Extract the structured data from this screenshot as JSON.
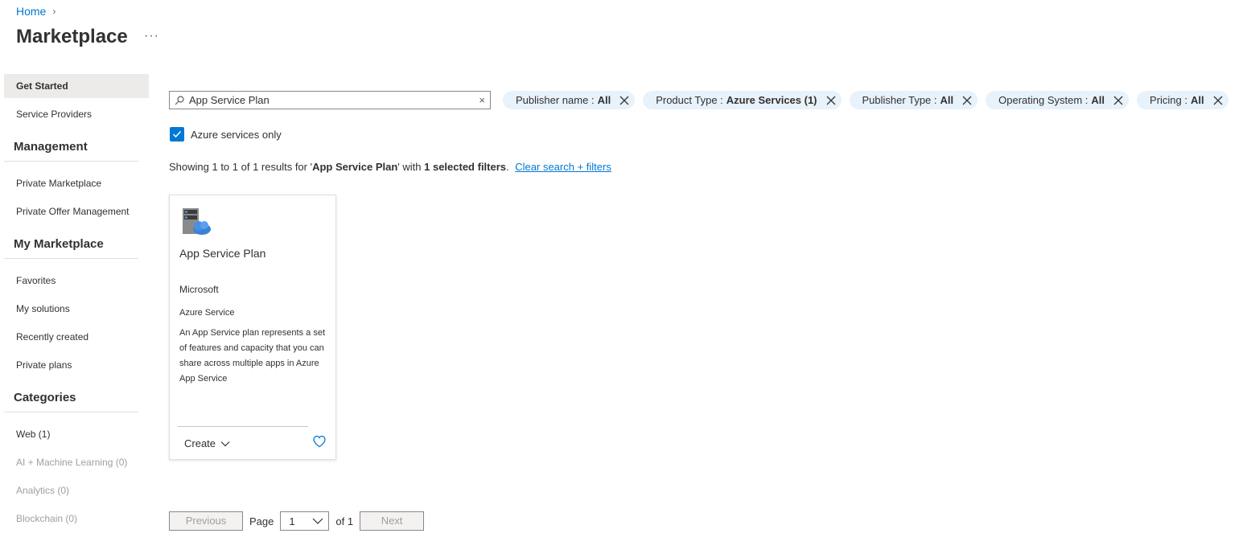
{
  "breadcrumb": {
    "home": "Home",
    "chevron": "›"
  },
  "page": {
    "title": "Marketplace",
    "more": "···"
  },
  "sidebar": {
    "items_top": [
      {
        "label": "Get Started"
      },
      {
        "label": "Service Providers"
      }
    ],
    "management": {
      "title": "Management",
      "items": [
        {
          "label": "Private Marketplace"
        },
        {
          "label": "Private Offer Management"
        }
      ]
    },
    "my_marketplace": {
      "title": "My Marketplace",
      "items": [
        {
          "label": "Favorites"
        },
        {
          "label": "My solutions"
        },
        {
          "label": "Recently created"
        },
        {
          "label": "Private plans"
        }
      ]
    },
    "categories": {
      "title": "Categories",
      "items": [
        {
          "label": "Web (1)"
        },
        {
          "label": "AI + Machine Learning (0)"
        },
        {
          "label": "Analytics (0)"
        },
        {
          "label": "Blockchain (0)"
        }
      ]
    }
  },
  "search": {
    "value": "App Service Plan",
    "clear": "×"
  },
  "filters": [
    {
      "label": "Publisher name :",
      "value": "All"
    },
    {
      "label": "Product Type :",
      "value": "Azure Services (1)"
    },
    {
      "label": "Publisher Type :",
      "value": "All"
    },
    {
      "label": "Operating System :",
      "value": "All"
    },
    {
      "label": "Pricing :",
      "value": "All"
    }
  ],
  "azure_only": {
    "label": "Azure services only",
    "checked": true
  },
  "results": {
    "prefix": "Showing 1 to 1 of 1 results for '",
    "query": "App Service Plan",
    "mid": "' with ",
    "filters_count": "1 selected filters",
    "suffix": ".",
    "clear_link": "Clear search + filters"
  },
  "card": {
    "title": "App Service Plan",
    "publisher": "Microsoft",
    "type": "Azure Service",
    "description": "An App Service plan represents a set of features and capacity that you can share across multiple apps in Azure App Service",
    "create": "Create"
  },
  "pager": {
    "previous": "Previous",
    "page_label": "Page",
    "page": "1",
    "of": "of 1",
    "next": "Next"
  },
  "colors": {
    "accent": "#0078d4",
    "pill_bg": "#e8f2fb",
    "active_nav": "#edebe9"
  }
}
